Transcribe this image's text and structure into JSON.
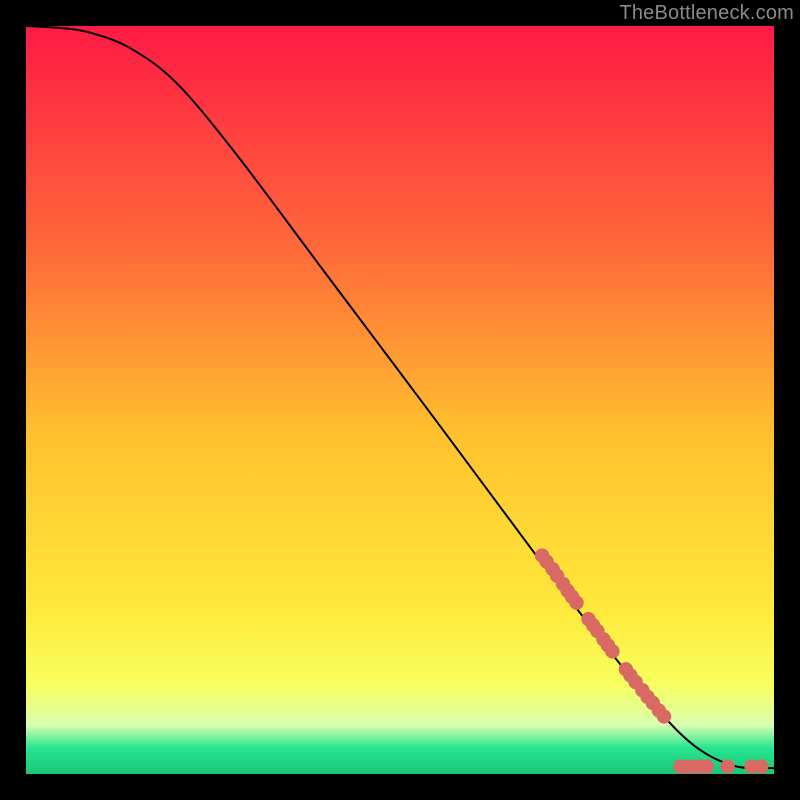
{
  "attribution": "TheBottleneck.com",
  "colors": {
    "bg": "#000000",
    "attribution_text": "#8a8a8a",
    "curve": "#000000",
    "marker_fill": "#d86a63",
    "marker_stroke": "#9b4a45",
    "gradient_stops": [
      {
        "offset": 0.0,
        "color": "#ff1a44"
      },
      {
        "offset": 0.3,
        "color": "#ff6a3a"
      },
      {
        "offset": 0.55,
        "color": "#ffc22e"
      },
      {
        "offset": 0.78,
        "color": "#ffe93a"
      },
      {
        "offset": 0.88,
        "color": "#f8ff5e"
      },
      {
        "offset": 0.935,
        "color": "#d6ffb0"
      },
      {
        "offset": 0.965,
        "color": "#27e58f"
      },
      {
        "offset": 1.0,
        "color": "#18c77a"
      }
    ]
  },
  "chart_data": {
    "type": "line",
    "title": "",
    "xlabel": "",
    "ylabel": "",
    "xlim": [
      0,
      100
    ],
    "ylim": [
      0,
      100
    ],
    "grid": false,
    "curve_points": [
      {
        "x": 0,
        "y": 100
      },
      {
        "x": 5,
        "y": 99.7
      },
      {
        "x": 9,
        "y": 99
      },
      {
        "x": 14,
        "y": 97
      },
      {
        "x": 20,
        "y": 92.5
      },
      {
        "x": 28,
        "y": 83
      },
      {
        "x": 40,
        "y": 67
      },
      {
        "x": 55,
        "y": 47
      },
      {
        "x": 68,
        "y": 29.5
      },
      {
        "x": 78,
        "y": 16.5
      },
      {
        "x": 85,
        "y": 8
      },
      {
        "x": 90,
        "y": 3.3
      },
      {
        "x": 95,
        "y": 1
      },
      {
        "x": 100,
        "y": 0.8
      }
    ],
    "series": [
      {
        "name": "markers-on-curve",
        "type": "scatter",
        "points": [
          {
            "x": 69.0,
            "y": 29.2
          },
          {
            "x": 69.6,
            "y": 28.4
          },
          {
            "x": 70.4,
            "y": 27.4
          },
          {
            "x": 71.0,
            "y": 26.5
          },
          {
            "x": 71.8,
            "y": 25.4
          },
          {
            "x": 72.4,
            "y": 24.5
          },
          {
            "x": 73.0,
            "y": 23.7
          },
          {
            "x": 73.6,
            "y": 22.9
          },
          {
            "x": 75.2,
            "y": 20.7
          },
          {
            "x": 75.8,
            "y": 19.9
          },
          {
            "x": 76.4,
            "y": 19.1
          },
          {
            "x": 77.2,
            "y": 18.0
          },
          {
            "x": 77.8,
            "y": 17.2
          },
          {
            "x": 78.4,
            "y": 16.4
          },
          {
            "x": 80.2,
            "y": 14.0
          },
          {
            "x": 80.8,
            "y": 13.2
          },
          {
            "x": 81.5,
            "y": 12.3
          },
          {
            "x": 82.4,
            "y": 11.2
          },
          {
            "x": 83.1,
            "y": 10.3
          },
          {
            "x": 83.8,
            "y": 9.5
          },
          {
            "x": 84.6,
            "y": 8.5
          },
          {
            "x": 85.3,
            "y": 7.7
          }
        ]
      },
      {
        "name": "markers-bottom",
        "type": "scatter",
        "points": [
          {
            "x": 87.5,
            "y": 1.0
          },
          {
            "x": 88.5,
            "y": 1.0
          },
          {
            "x": 89.5,
            "y": 1.0
          },
          {
            "x": 90.2,
            "y": 1.0
          },
          {
            "x": 91.0,
            "y": 1.0
          },
          {
            "x": 93.8,
            "y": 1.0
          },
          {
            "x": 97.0,
            "y": 1.0
          },
          {
            "x": 98.3,
            "y": 1.0
          }
        ]
      }
    ]
  }
}
